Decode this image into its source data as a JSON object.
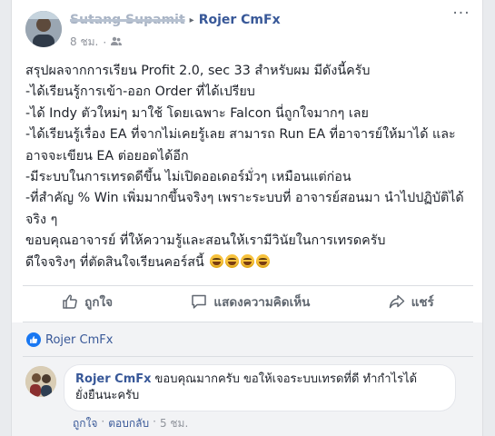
{
  "post": {
    "author_name": "Sutang Supamit",
    "arrow": "▸",
    "target_name": "Rojer CmFx",
    "time": "8 ชม.",
    "privacy_separator": "·",
    "privacy_icon": "friends-icon",
    "more_label": "···",
    "lines": [
      "สรุปผลจากการเรียน Profit 2.0, sec 33 สำหรับผม มีดังนี้ครับ",
      "-ได้เรียนรู้การเข้า-ออก Order ที่ได้เปรียบ",
      "-ได้ Indy ตัวใหม่ๆ มาใช้ โดยเฉพาะ Falcon นี่ถูกใจมากๆ เลย",
      "-ได้เรียนรู้เรื่อง EA ที่จากไม่เคยรู้เลย สามารถ Run EA ที่อาจารย์ให้มาได้ และอาจจะเขียน EA ต่อยอดได้อีก",
      "-มีระบบในการเทรดดีขึ้น ไม่เปิดออเดอร์มั่วๆ เหมือนแต่ก่อน",
      "-ที่สำคัญ % Win เพิ่มมากขึ้นจริงๆ เพราะระบบที่ อาจารย์สอนมา นำไปปฏิบัติได้จริง ๆ",
      "ขอบคุณอาจารย์ ที่ให้ความรู้และสอนให้เรามีวินัยในการเทรดครับ",
      "ดีใจจริงๆ ที่ตัดสินใจเรียนคอร์สนี้"
    ],
    "emoji_count": 4
  },
  "actions": {
    "like": "ถูกใจ",
    "comment": "แสดงความคิดเห็น",
    "share": "แชร์"
  },
  "reactions": {
    "name": "Rojer CmFx"
  },
  "comment": {
    "author": "Rojer CmFx",
    "text": "ขอบคุณมากครับ ขอให้เจอระบบเทรดที่ดี ทำกำไรได้ยั่งยืนนะครับ",
    "like_link": "ถูกใจ",
    "separator": "·",
    "reply_link": "ตอบกลับ",
    "time": "5 ชม."
  },
  "colors": {
    "link_blue": "#385898",
    "like_blue": "#1877f2",
    "muted_gray": "#90949c",
    "action_gray": "#606770"
  }
}
